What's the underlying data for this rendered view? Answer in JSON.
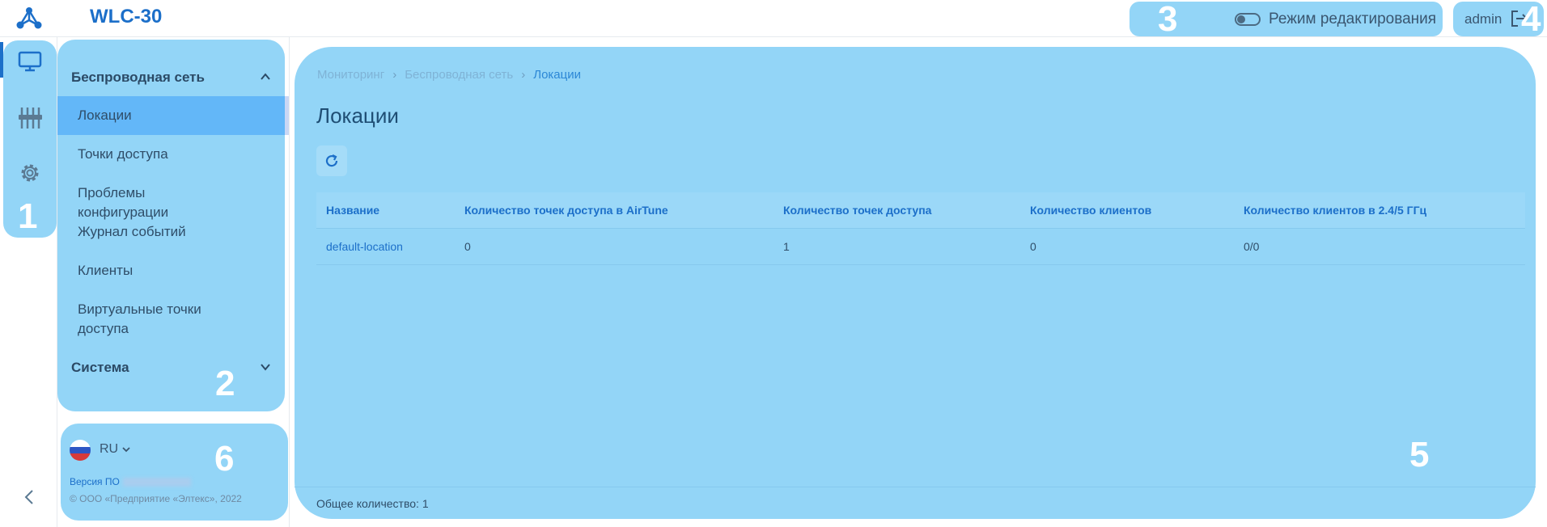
{
  "app": {
    "title": "WLC-30"
  },
  "header": {
    "edit_mode_label": "Режим редактирования",
    "user_name": "admin"
  },
  "rail": {
    "items": [
      {
        "icon": "monitor-icon",
        "active": true
      },
      {
        "icon": "sliders-icon",
        "active": false
      },
      {
        "icon": "gear-icon",
        "active": false
      }
    ]
  },
  "nav": {
    "group_wireless": "Беспроводная сеть",
    "items": [
      {
        "label": "Локации",
        "active": true
      },
      {
        "label": "Точки доступа"
      },
      {
        "label": "Проблемы конфигурации"
      },
      {
        "label": "Журнал событий"
      },
      {
        "label": "Клиенты"
      },
      {
        "label": "Виртуальные точки доступа"
      }
    ],
    "group_system": "Система"
  },
  "footer": {
    "lang": "RU",
    "version_label": "Версия ПО",
    "copyright": "© ООО «Предприятие «Элтекс», 2022"
  },
  "main": {
    "breadcrumb": [
      "Мониторинг",
      "Беспроводная сеть",
      "Локации"
    ],
    "title": "Локации",
    "table": {
      "headers": [
        "Название",
        "Количество точек доступа в AirTune",
        "Количество точек доступа",
        "Количество клиентов",
        "Количество клиентов в 2.4/5 ГГц"
      ],
      "rows": [
        [
          "default-location",
          "0",
          "1",
          "0",
          "0/0"
        ]
      ]
    },
    "total_label": "Общее количество:",
    "total_value": "1"
  },
  "overlay_numbers": [
    "1",
    "2",
    "3",
    "4",
    "5",
    "6"
  ],
  "colors": {
    "accent": "#1c6fc9",
    "highlight": "#93d5f7",
    "active_item": "#63b7f8"
  }
}
